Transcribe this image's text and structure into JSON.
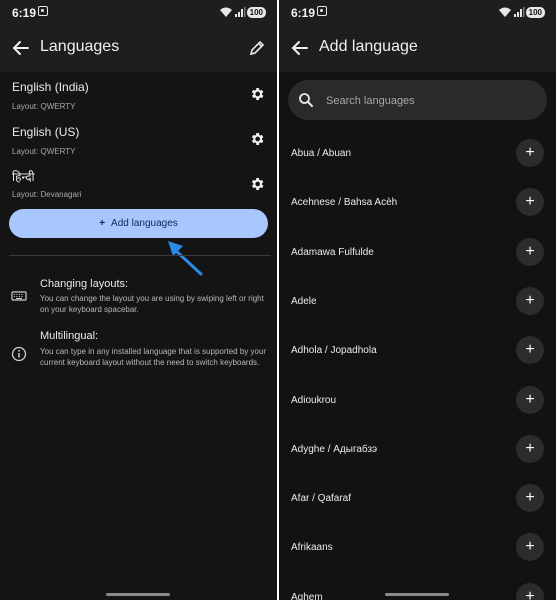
{
  "status_bar": {
    "time": "6:19",
    "battery": "100"
  },
  "left": {
    "title": "Languages",
    "languages": [
      {
        "name": "English (India)",
        "layout": "Layout: QWERTY"
      },
      {
        "name": "English (US)",
        "layout": "Layout: QWERTY"
      },
      {
        "name": "हिन्दी",
        "layout": "Layout: Devanagari"
      }
    ],
    "add_button": "Add languages",
    "tips": [
      {
        "title": "Changing layouts:",
        "text": "You can change the layout you are using by swiping left or right on your keyboard spacebar.",
        "icon": "keyboard-icon"
      },
      {
        "title": "Multilingual:",
        "text": "You can type in any installed language that is supported by your current keyboard layout without the need to switch keyboards.",
        "icon": "info-icon"
      }
    ]
  },
  "right": {
    "title": "Add language",
    "search_placeholder": "Search languages",
    "languages": [
      "Abua / Abuan",
      "Acehnese / Bahsa Acèh",
      "Adamawa Fulfulde",
      "Adele",
      "Adhola / Jopadhola",
      "Adioukrou",
      "Adyghe / Адыгабзэ",
      "Afar / Qafaraf",
      "Afrikaans",
      "Aghem"
    ]
  },
  "colors": {
    "accent": "#a9c7ff",
    "pointer": "#2a8be6",
    "background": "#141414"
  }
}
